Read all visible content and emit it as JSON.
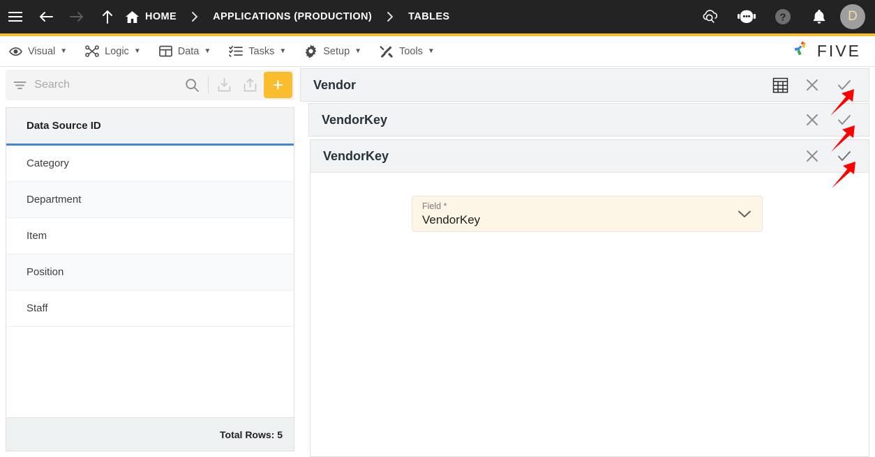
{
  "topbar": {
    "menu_icon": "hamburger-menu-icon",
    "back_icon": "arrow-left-icon",
    "forward_icon": "arrow-right-icon",
    "up_icon": "arrow-up-icon",
    "breadcrumbs": [
      {
        "label": "HOME",
        "icon": "home-icon"
      },
      {
        "label": "APPLICATIONS (PRODUCTION)",
        "icon": ""
      },
      {
        "label": "TABLES",
        "icon": ""
      }
    ],
    "separator": "›",
    "actions": [
      {
        "name": "cloud-search-icon"
      },
      {
        "name": "chatbot-icon"
      },
      {
        "name": "help-icon"
      },
      {
        "name": "notifications-bell-icon"
      }
    ],
    "avatar_initial": "D",
    "bg_color": "#232323",
    "accent_color": "#FBBC2E"
  },
  "menubar": {
    "items": [
      {
        "label": "Visual",
        "icon": "eye-icon",
        "caret": "▼"
      },
      {
        "label": "Logic",
        "icon": "nodes-icon",
        "caret": "▼"
      },
      {
        "label": "Data",
        "icon": "table-icon",
        "caret": "▼"
      },
      {
        "label": "Tasks",
        "icon": "checklist-icon",
        "caret": "▼"
      },
      {
        "label": "Setup",
        "icon": "gear-icon",
        "caret": "▼"
      },
      {
        "label": "Tools",
        "icon": "tools-icon",
        "caret": "▼"
      }
    ],
    "brand": {
      "text": "FIVE",
      "icon": "five-logo-icon"
    }
  },
  "sidebar": {
    "search": {
      "placeholder": "Search",
      "value": "",
      "filter_icon": "filter-icon",
      "search_icon": "search-icon"
    },
    "toolbar": [
      {
        "name": "import-icon"
      },
      {
        "name": "export-icon"
      },
      {
        "name": "add-button",
        "label": "+"
      }
    ],
    "table": {
      "column_header": "Data Source ID",
      "rows": [
        {
          "name": "Category"
        },
        {
          "name": "Department"
        },
        {
          "name": "Item"
        },
        {
          "name": "Position"
        },
        {
          "name": "Staff"
        }
      ],
      "footer": "Total Rows: 5"
    }
  },
  "main": {
    "cards": [
      {
        "title": "Vendor",
        "actions": [
          {
            "name": "grid-view-icon"
          },
          {
            "name": "close-icon"
          },
          {
            "name": "confirm-check-icon"
          }
        ]
      },
      {
        "title": "VendorKey",
        "actions": [
          {
            "name": "close-icon"
          },
          {
            "name": "confirm-check-icon"
          }
        ]
      },
      {
        "title": "VendorKey",
        "actions": [
          {
            "name": "close-icon"
          },
          {
            "name": "confirm-check-icon"
          }
        ]
      }
    ],
    "field": {
      "label": "Field *",
      "value": "VendorKey",
      "caret_icon": "chevron-down-icon",
      "bg_color": "#FDF5E6"
    }
  },
  "annotations": {
    "arrow_color": "#FF0000",
    "arrows": [
      {
        "name": "annotation-arrow-card1-check"
      },
      {
        "name": "annotation-arrow-card2-check"
      },
      {
        "name": "annotation-arrow-card3-check"
      }
    ]
  }
}
